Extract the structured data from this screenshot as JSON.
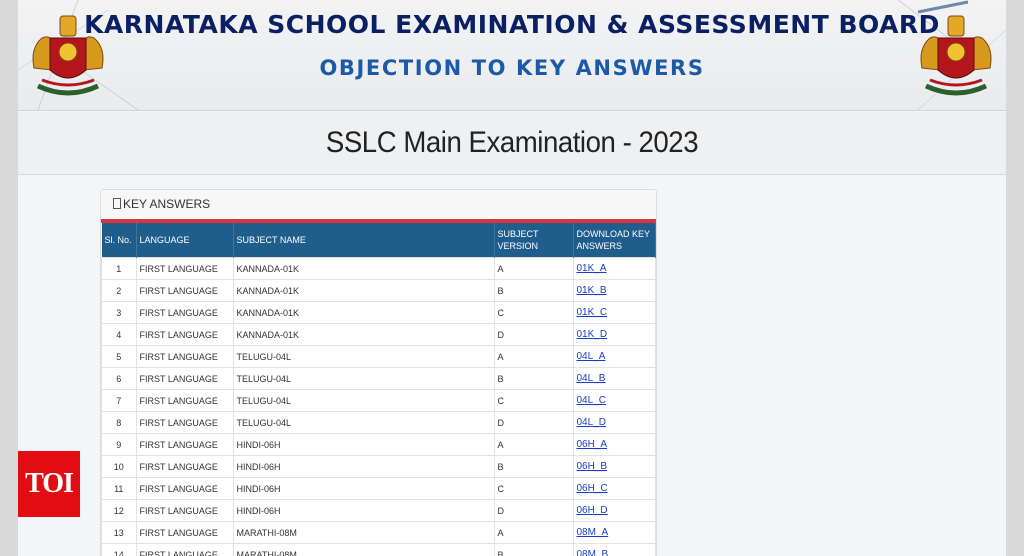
{
  "header": {
    "board_title": "KARNATAKA SCHOOL EXAMINATION & ASSESSMENT BOARD",
    "sub_title": "OBJECTION TO KEY ANSWERS",
    "emblem_icon": "karnataka-emblem-icon"
  },
  "exam": {
    "title": "SSLC Main Examination - 2023"
  },
  "panel": {
    "title": "KEY ANSWERS",
    "columns": [
      "Sl. No.",
      "LANGUAGE",
      "SUBJECT NAME",
      "SUBJECT VERSION",
      "DOWNLOAD KEY ANSWERS"
    ],
    "rows": [
      {
        "sl": "1",
        "lang": "FIRST LANGUAGE",
        "subject": "KANNADA-01K",
        "version": "A",
        "link": "01K_A"
      },
      {
        "sl": "2",
        "lang": "FIRST LANGUAGE",
        "subject": "KANNADA-01K",
        "version": "B",
        "link": "01K_B"
      },
      {
        "sl": "3",
        "lang": "FIRST LANGUAGE",
        "subject": "KANNADA-01K",
        "version": "C",
        "link": "01K_C"
      },
      {
        "sl": "4",
        "lang": "FIRST LANGUAGE",
        "subject": "KANNADA-01K",
        "version": "D",
        "link": "01K_D"
      },
      {
        "sl": "5",
        "lang": "FIRST LANGUAGE",
        "subject": "TELUGU-04L",
        "version": "A",
        "link": "04L_A"
      },
      {
        "sl": "6",
        "lang": "FIRST LANGUAGE",
        "subject": "TELUGU-04L",
        "version": "B",
        "link": "04L_B"
      },
      {
        "sl": "7",
        "lang": "FIRST LANGUAGE",
        "subject": "TELUGU-04L",
        "version": "C",
        "link": "04L_C"
      },
      {
        "sl": "8",
        "lang": "FIRST LANGUAGE",
        "subject": "TELUGU-04L",
        "version": "D",
        "link": "04L_D"
      },
      {
        "sl": "9",
        "lang": "FIRST LANGUAGE",
        "subject": "HINDI-06H",
        "version": "A",
        "link": "06H_A"
      },
      {
        "sl": "10",
        "lang": "FIRST LANGUAGE",
        "subject": "HINDI-06H",
        "version": "B",
        "link": "06H_B"
      },
      {
        "sl": "11",
        "lang": "FIRST LANGUAGE",
        "subject": "HINDI-06H",
        "version": "C",
        "link": "06H_C"
      },
      {
        "sl": "12",
        "lang": "FIRST LANGUAGE",
        "subject": "HINDI-06H",
        "version": "D",
        "link": "06H_D"
      },
      {
        "sl": "13",
        "lang": "FIRST LANGUAGE",
        "subject": "MARATHI-08M",
        "version": "A",
        "link": "08M_A"
      },
      {
        "sl": "14",
        "lang": "FIRST LANGUAGE",
        "subject": "MARATHI-08M",
        "version": "B",
        "link": "08M_B"
      }
    ]
  },
  "watermark": {
    "label": "TOI"
  },
  "colors": {
    "title": "#0b1f63",
    "subtitle": "#1a5aa8",
    "table_header": "#1f5d8c",
    "accent": "#d9363e",
    "link": "#1a3cc8",
    "watermark": "#e10d12"
  }
}
